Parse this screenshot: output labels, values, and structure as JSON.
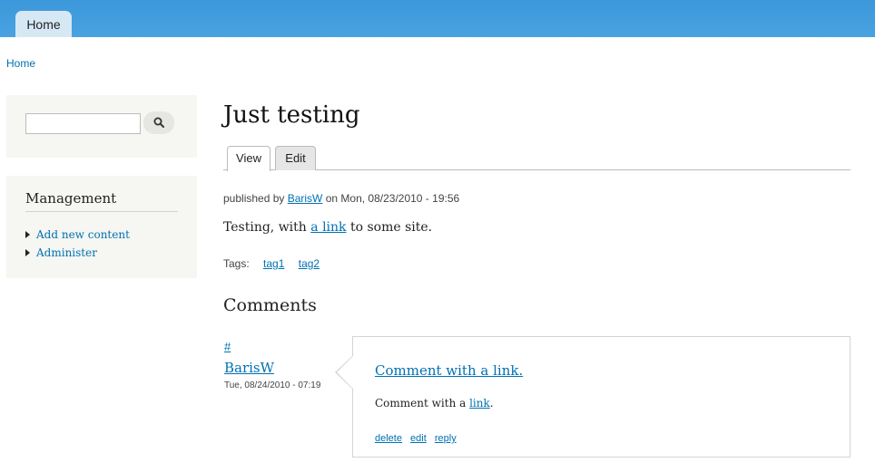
{
  "nav": {
    "home_tab": "Home"
  },
  "breadcrumb": {
    "home": "Home"
  },
  "search": {
    "value": "",
    "placeholder": ""
  },
  "management": {
    "title": "Management",
    "items": [
      {
        "label": "Add new content"
      },
      {
        "label": "Administer"
      }
    ]
  },
  "node": {
    "title": "Just testing",
    "tabs": [
      {
        "label": "View",
        "active": true
      },
      {
        "label": "Edit",
        "active": false
      }
    ],
    "submitted": {
      "prefix": "published by ",
      "author": "BarisW",
      "suffix": " on Mon, 08/23/2010 - 19:56"
    },
    "body": {
      "before": "Testing, with ",
      "link": "a link",
      "after": " to some site."
    },
    "tags": {
      "label": "Tags:",
      "items": [
        "tag1",
        "tag2"
      ]
    }
  },
  "comments": {
    "title": "Comments",
    "items": [
      {
        "permalink": "#",
        "author": "BarisW",
        "date": "Tue, 08/24/2010 - 07:19",
        "title": "Comment with a link.",
        "body_before": "Comment with a ",
        "body_link": "link",
        "body_after": ".",
        "links": {
          "delete": "delete",
          "edit": "edit",
          "reply": "reply"
        }
      }
    ]
  },
  "colors": {
    "header_blue": "#3b98db",
    "link": "#0071b3",
    "sidebar_bg": "#f6f6f2"
  },
  "icons": {
    "search": "magnifier-icon",
    "bullet": "triangle-right-icon"
  }
}
